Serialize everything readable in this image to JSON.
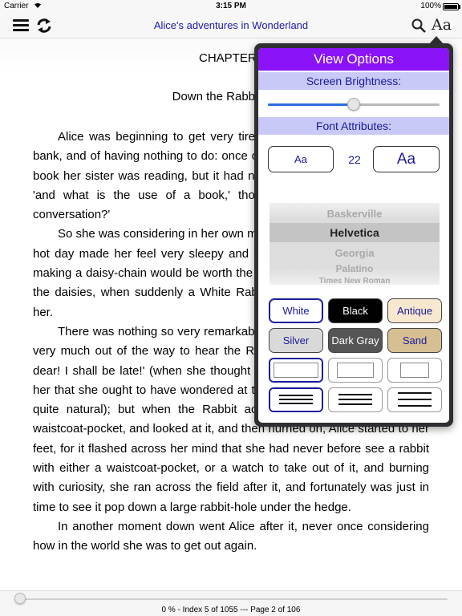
{
  "status_bar": {
    "carrier": "Carrier",
    "time": "3:15 PM",
    "battery": "100%"
  },
  "nav": {
    "title": "Alice's adventures in Wonderland",
    "font_button_label": "Aa"
  },
  "content": {
    "chapter_title": "CHAPTER I",
    "chapter_subtitle": "Down the Rabbit-Hole",
    "paragraphs": [
      "Alice was beginning to get very tired of sitting by her sister on the bank, and of having nothing to do: once or twice she had peeped into the book her sister was reading, but it had no pictures or conversations in it, 'and what is the use of a book,' thought Alice 'without pictures or conversation?'",
      "So she was considering in her own mind (as well as she could, for the hot day made her feel very sleepy and stupid), whether the pleasure of making a daisy-chain would be worth the trouble of getting up and picking the daisies, when suddenly a White Rabbit with pink eyes ran close by her.",
      "There was nothing so very remarkable in that; nor did Alice think it so very much out of the way to hear the Rabbit say to itself, 'Oh dear! Oh dear! I shall be late!' (when she thought it over afterwards, it occurred to her that she ought to have wondered at this, but at the time it all seemed quite natural); but when the Rabbit actually took a watch out of its waistcoat-pocket, and looked at it, and then hurried on, Alice started to her feet, for it flashed across her mind that she had never before see a rabbit with either a waistcoat-pocket, or a watch to take out of it, and burning with curiosity, she ran across the field after it, and fortunately was just in time to see it pop down a large rabbit-hole under the hedge.",
      "In another moment down went Alice after it, never once considering how in the world she was to get out again."
    ]
  },
  "bottom_bar": {
    "progress_text": "0 % - Index 5 of 1055 --- Page 2 of 106",
    "progress_fraction": 0.0
  },
  "view_options": {
    "title": "View Options",
    "brightness_label": "Screen Brightness:",
    "brightness_value": 0.5,
    "font_attributes_label": "Font Attributes:",
    "smaller_font_label": "Aa",
    "font_size": "22",
    "larger_font_label": "Aa",
    "fonts": [
      "Baskerville",
      "Helvetica",
      "Georgia",
      "Palatino",
      "Times New Roman"
    ],
    "selected_font": "Helvetica",
    "themes": [
      {
        "label": "White",
        "bg": "#ffffff",
        "fg": "#1a1a9a",
        "selected": true
      },
      {
        "label": "Black",
        "bg": "#000000",
        "fg": "#ffffff",
        "selected": false
      },
      {
        "label": "Antique",
        "bg": "#f8e8d0",
        "fg": "#1a1a9a",
        "selected": false
      },
      {
        "label": "Silver",
        "bg": "#d9d9d9",
        "fg": "#1a1a9a",
        "selected": false
      },
      {
        "label": "Dark Gray",
        "bg": "#555555",
        "fg": "#ffffff",
        "selected": false
      },
      {
        "label": "Sand",
        "bg": "#d6bf93",
        "fg": "#1a1a9a",
        "selected": false
      }
    ],
    "accent": "#8a14f7",
    "section_color": "#c9c9f7"
  }
}
